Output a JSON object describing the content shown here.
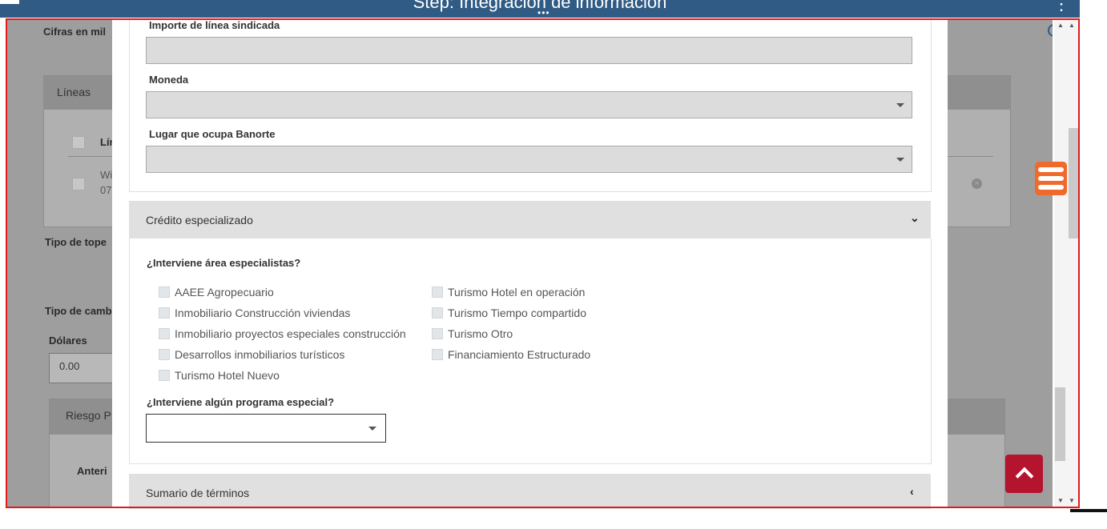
{
  "header": {
    "title": "Step: Integración de información",
    "menu_icon": "menu-icon",
    "more_icon": "more-vertical-icon"
  },
  "background": {
    "cifras_label": "Cifras en mil",
    "lineas_title": "Líneas",
    "lineas_col": "Lín",
    "row_text_1": "Wi",
    "row_text_2": "07",
    "tipo_tope": "Tipo de tope",
    "tipo_cambio": "Tipo de camb",
    "dolares_label": "Dólares",
    "dolares_value": "0.00",
    "riesgo_title": "Riesgo P",
    "anterior_label": "Anteri"
  },
  "modal": {
    "importe_label": "Importe de línea sindicada",
    "moneda_label": "Moneda",
    "lugar_label": "Lugar que ocupa Banorte",
    "credito_section": "Crédito especializado",
    "interviene_area_label": "¿Interviene área especialistas?",
    "options_left": [
      "AAEE Agropecuario",
      "Inmobiliario Construcción viviendas",
      "Inmobiliario proyectos especiales construcción",
      "Desarrollos inmobiliarios turísticos",
      "Turismo Hotel Nuevo"
    ],
    "options_right": [
      "Turismo Hotel en operación",
      "Turismo Tiempo compartido",
      "Turismo Otro",
      "Financiamiento Estructurado"
    ],
    "programa_label": "¿Interviene algún programa especial?",
    "sumario_section": "Sumario de términos"
  },
  "colors": {
    "header": "#2f5b84",
    "fab_orange": "#f06a2b",
    "scroll_top_red": "#b5142e",
    "frame_red": "#e01b1b"
  }
}
